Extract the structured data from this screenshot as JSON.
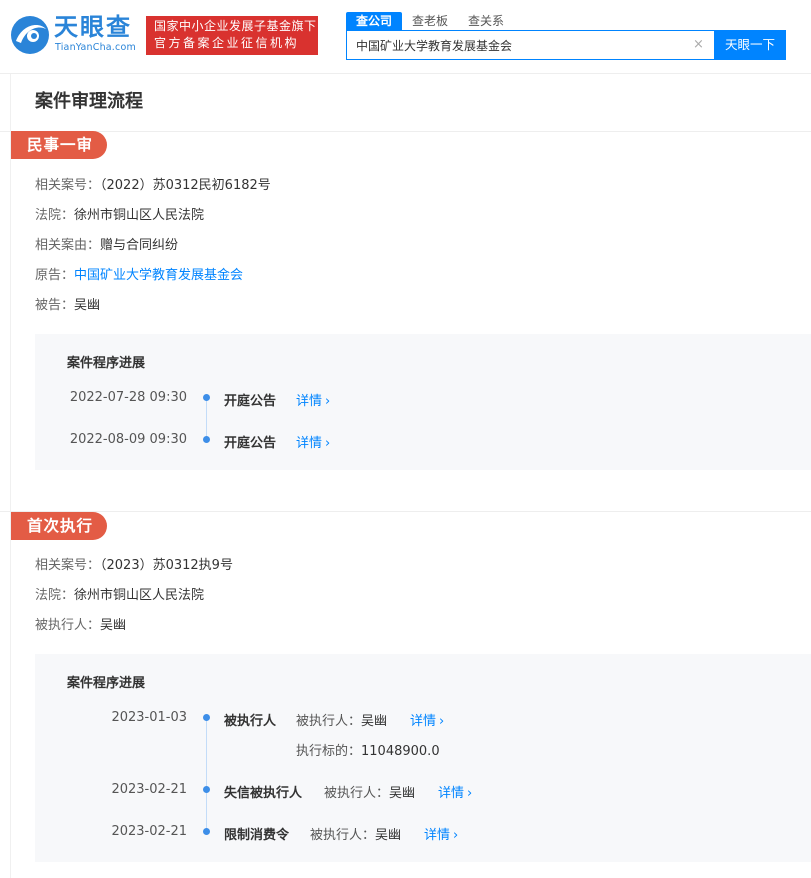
{
  "header": {
    "logo_text": "天眼查",
    "logo_sub": "TianYanCha.com",
    "slogan_line1": "国家中小企业发展子基金旗下",
    "slogan_line2": "官方备案企业征信机构",
    "tabs": [
      "查公司",
      "查老板",
      "查关系"
    ],
    "search_value": "中国矿业大学教育发展基金会",
    "clear_icon": "×",
    "search_button": "天眼一下"
  },
  "page": {
    "title": "案件审理流程"
  },
  "sections": [
    {
      "tag": "民事一审",
      "fields": [
        {
          "key": "相关案号：",
          "value": "（2022）苏0312民初6182号"
        },
        {
          "key": "法院：",
          "value": "徐州市铜山区人民法院"
        },
        {
          "key": "相关案由：",
          "value": "赠与合同纠纷"
        },
        {
          "key": "原告：",
          "value": "中国矿业大学教育发展基金会"
        },
        {
          "key": "被告：",
          "value": "吴幽"
        }
      ],
      "progress_title": "案件程序进展",
      "timeline": [
        {
          "date": "2022-07-28 09:30",
          "event": "开庭公告",
          "link": "详情"
        },
        {
          "date": "2022-08-09 09:30",
          "event": "开庭公告",
          "link": "详情"
        }
      ]
    },
    {
      "tag": "首次执行",
      "fields": [
        {
          "key": "相关案号：",
          "value": "（2023）苏0312执9号"
        },
        {
          "key": "法院：",
          "value": "徐州市铜山区人民法院"
        },
        {
          "key": "被执行人：",
          "value": "吴幽"
        }
      ],
      "progress_title": "案件程序进展",
      "timeline": [
        {
          "date": "2023-01-03",
          "event": "被执行人",
          "detail_key": "被执行人：",
          "detail_value": "吴幽",
          "link": "详情",
          "extra_key": "执行标的：",
          "extra_value": "11048900.0"
        },
        {
          "date": "2023-02-21",
          "event": "失信被执行人",
          "detail_key": "被执行人：",
          "detail_value": "吴幽",
          "link": "详情"
        },
        {
          "date": "2023-02-21",
          "event": "限制消费令",
          "detail_key": "被执行人：",
          "detail_value": "吴幽",
          "link": "详情"
        }
      ]
    }
  ],
  "colors": {
    "brand_blue": "#0084ff",
    "logo_blue": "#2a84d8",
    "slogan_red": "#d9322f",
    "tag_red": "#e35c45",
    "timeline_dot": "#3d8ee8"
  }
}
